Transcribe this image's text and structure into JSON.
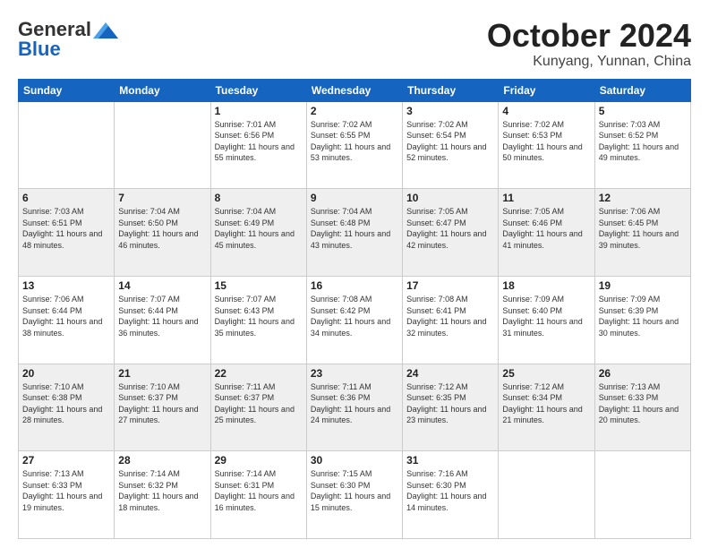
{
  "header": {
    "logo_general": "General",
    "logo_blue": "Blue",
    "month": "October 2024",
    "location": "Kunyang, Yunnan, China"
  },
  "weekdays": [
    "Sunday",
    "Monday",
    "Tuesday",
    "Wednesday",
    "Thursday",
    "Friday",
    "Saturday"
  ],
  "weeks": [
    [
      {
        "day": "",
        "sunrise": "",
        "sunset": "",
        "daylight": ""
      },
      {
        "day": "",
        "sunrise": "",
        "sunset": "",
        "daylight": ""
      },
      {
        "day": "1",
        "sunrise": "Sunrise: 7:01 AM",
        "sunset": "Sunset: 6:56 PM",
        "daylight": "Daylight: 11 hours and 55 minutes."
      },
      {
        "day": "2",
        "sunrise": "Sunrise: 7:02 AM",
        "sunset": "Sunset: 6:55 PM",
        "daylight": "Daylight: 11 hours and 53 minutes."
      },
      {
        "day": "3",
        "sunrise": "Sunrise: 7:02 AM",
        "sunset": "Sunset: 6:54 PM",
        "daylight": "Daylight: 11 hours and 52 minutes."
      },
      {
        "day": "4",
        "sunrise": "Sunrise: 7:02 AM",
        "sunset": "Sunset: 6:53 PM",
        "daylight": "Daylight: 11 hours and 50 minutes."
      },
      {
        "day": "5",
        "sunrise": "Sunrise: 7:03 AM",
        "sunset": "Sunset: 6:52 PM",
        "daylight": "Daylight: 11 hours and 49 minutes."
      }
    ],
    [
      {
        "day": "6",
        "sunrise": "Sunrise: 7:03 AM",
        "sunset": "Sunset: 6:51 PM",
        "daylight": "Daylight: 11 hours and 48 minutes."
      },
      {
        "day": "7",
        "sunrise": "Sunrise: 7:04 AM",
        "sunset": "Sunset: 6:50 PM",
        "daylight": "Daylight: 11 hours and 46 minutes."
      },
      {
        "day": "8",
        "sunrise": "Sunrise: 7:04 AM",
        "sunset": "Sunset: 6:49 PM",
        "daylight": "Daylight: 11 hours and 45 minutes."
      },
      {
        "day": "9",
        "sunrise": "Sunrise: 7:04 AM",
        "sunset": "Sunset: 6:48 PM",
        "daylight": "Daylight: 11 hours and 43 minutes."
      },
      {
        "day": "10",
        "sunrise": "Sunrise: 7:05 AM",
        "sunset": "Sunset: 6:47 PM",
        "daylight": "Daylight: 11 hours and 42 minutes."
      },
      {
        "day": "11",
        "sunrise": "Sunrise: 7:05 AM",
        "sunset": "Sunset: 6:46 PM",
        "daylight": "Daylight: 11 hours and 41 minutes."
      },
      {
        "day": "12",
        "sunrise": "Sunrise: 7:06 AM",
        "sunset": "Sunset: 6:45 PM",
        "daylight": "Daylight: 11 hours and 39 minutes."
      }
    ],
    [
      {
        "day": "13",
        "sunrise": "Sunrise: 7:06 AM",
        "sunset": "Sunset: 6:44 PM",
        "daylight": "Daylight: 11 hours and 38 minutes."
      },
      {
        "day": "14",
        "sunrise": "Sunrise: 7:07 AM",
        "sunset": "Sunset: 6:44 PM",
        "daylight": "Daylight: 11 hours and 36 minutes."
      },
      {
        "day": "15",
        "sunrise": "Sunrise: 7:07 AM",
        "sunset": "Sunset: 6:43 PM",
        "daylight": "Daylight: 11 hours and 35 minutes."
      },
      {
        "day": "16",
        "sunrise": "Sunrise: 7:08 AM",
        "sunset": "Sunset: 6:42 PM",
        "daylight": "Daylight: 11 hours and 34 minutes."
      },
      {
        "day": "17",
        "sunrise": "Sunrise: 7:08 AM",
        "sunset": "Sunset: 6:41 PM",
        "daylight": "Daylight: 11 hours and 32 minutes."
      },
      {
        "day": "18",
        "sunrise": "Sunrise: 7:09 AM",
        "sunset": "Sunset: 6:40 PM",
        "daylight": "Daylight: 11 hours and 31 minutes."
      },
      {
        "day": "19",
        "sunrise": "Sunrise: 7:09 AM",
        "sunset": "Sunset: 6:39 PM",
        "daylight": "Daylight: 11 hours and 30 minutes."
      }
    ],
    [
      {
        "day": "20",
        "sunrise": "Sunrise: 7:10 AM",
        "sunset": "Sunset: 6:38 PM",
        "daylight": "Daylight: 11 hours and 28 minutes."
      },
      {
        "day": "21",
        "sunrise": "Sunrise: 7:10 AM",
        "sunset": "Sunset: 6:37 PM",
        "daylight": "Daylight: 11 hours and 27 minutes."
      },
      {
        "day": "22",
        "sunrise": "Sunrise: 7:11 AM",
        "sunset": "Sunset: 6:37 PM",
        "daylight": "Daylight: 11 hours and 25 minutes."
      },
      {
        "day": "23",
        "sunrise": "Sunrise: 7:11 AM",
        "sunset": "Sunset: 6:36 PM",
        "daylight": "Daylight: 11 hours and 24 minutes."
      },
      {
        "day": "24",
        "sunrise": "Sunrise: 7:12 AM",
        "sunset": "Sunset: 6:35 PM",
        "daylight": "Daylight: 11 hours and 23 minutes."
      },
      {
        "day": "25",
        "sunrise": "Sunrise: 7:12 AM",
        "sunset": "Sunset: 6:34 PM",
        "daylight": "Daylight: 11 hours and 21 minutes."
      },
      {
        "day": "26",
        "sunrise": "Sunrise: 7:13 AM",
        "sunset": "Sunset: 6:33 PM",
        "daylight": "Daylight: 11 hours and 20 minutes."
      }
    ],
    [
      {
        "day": "27",
        "sunrise": "Sunrise: 7:13 AM",
        "sunset": "Sunset: 6:33 PM",
        "daylight": "Daylight: 11 hours and 19 minutes."
      },
      {
        "day": "28",
        "sunrise": "Sunrise: 7:14 AM",
        "sunset": "Sunset: 6:32 PM",
        "daylight": "Daylight: 11 hours and 18 minutes."
      },
      {
        "day": "29",
        "sunrise": "Sunrise: 7:14 AM",
        "sunset": "Sunset: 6:31 PM",
        "daylight": "Daylight: 11 hours and 16 minutes."
      },
      {
        "day": "30",
        "sunrise": "Sunrise: 7:15 AM",
        "sunset": "Sunset: 6:30 PM",
        "daylight": "Daylight: 11 hours and 15 minutes."
      },
      {
        "day": "31",
        "sunrise": "Sunrise: 7:16 AM",
        "sunset": "Sunset: 6:30 PM",
        "daylight": "Daylight: 11 hours and 14 minutes."
      },
      {
        "day": "",
        "sunrise": "",
        "sunset": "",
        "daylight": ""
      },
      {
        "day": "",
        "sunrise": "",
        "sunset": "",
        "daylight": ""
      }
    ]
  ]
}
